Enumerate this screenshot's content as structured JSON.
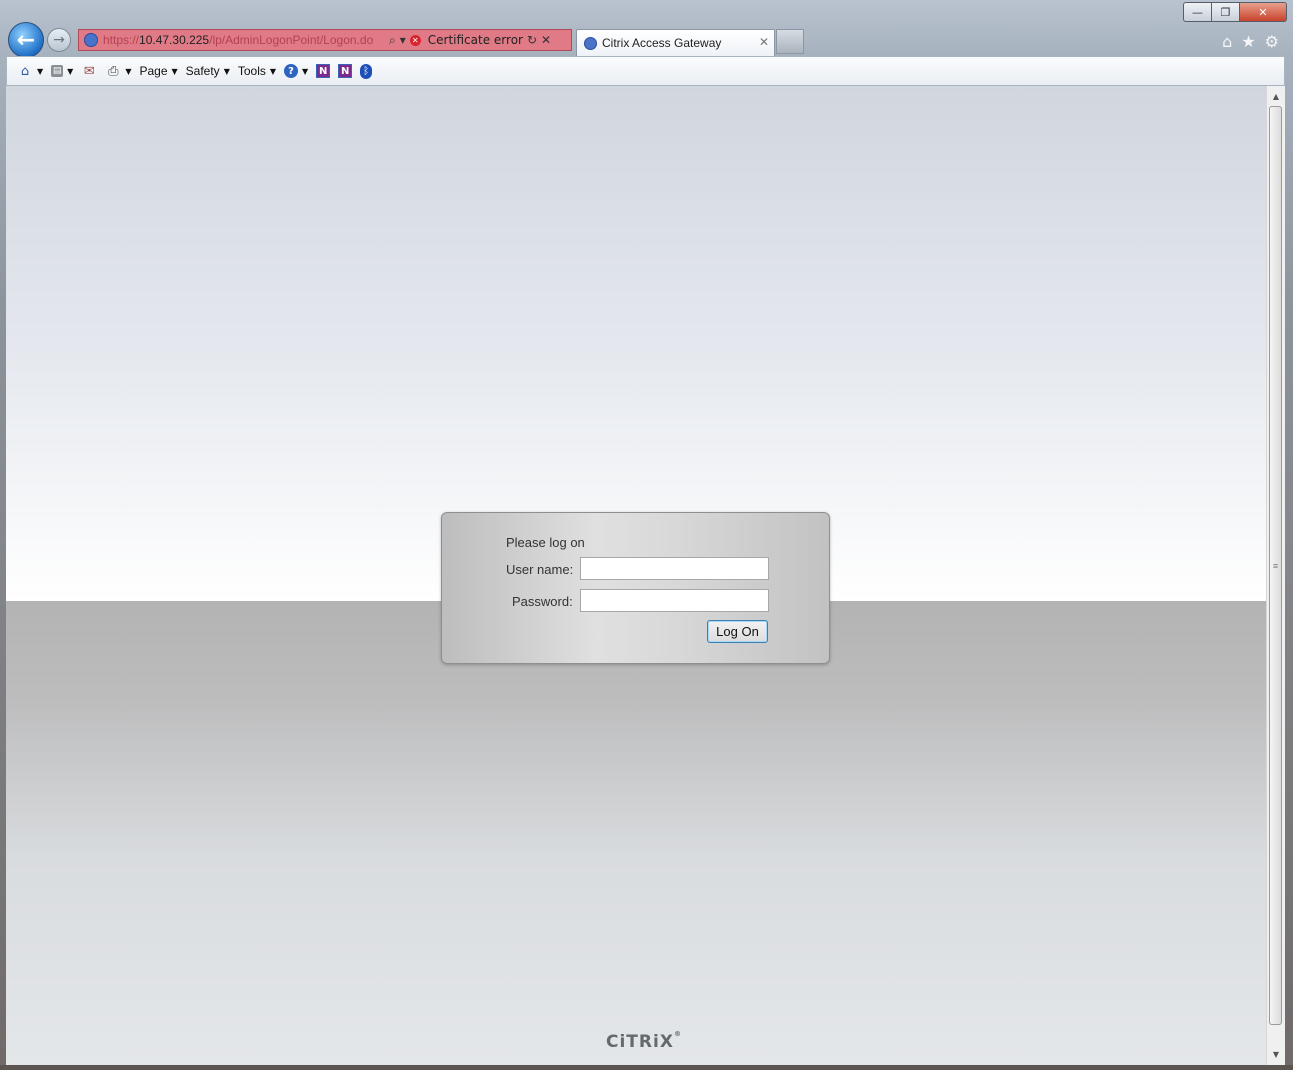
{
  "window": {
    "minimize_label": "—",
    "restore_label": "❐",
    "close_label": "✕"
  },
  "nav": {
    "back_icon": "←",
    "forward_icon": "→"
  },
  "address": {
    "url_scheme": "https://",
    "url_host": "10.47.30.225",
    "url_path": "/lp/AdminLogonPoint/Logon.do",
    "search_icon": "⌕",
    "dropdown_icon": "▾",
    "cert_error_icon": "✕",
    "cert_error_text": "Certificate error",
    "refresh_icon": "↻",
    "stop_icon": "✕",
    "error_color": "#e07a86"
  },
  "tab": {
    "title": "Citrix Access Gateway",
    "close_icon": "✕"
  },
  "browser_icons": {
    "home": "⌂",
    "favorites": "★",
    "tools": "⚙"
  },
  "toolbar": {
    "home_icon": "⌂",
    "feeds_icon": "▤",
    "mail_icon": "✉",
    "print_icon": "⎙",
    "page_label": "Page",
    "safety_label": "Safety",
    "tools_label": "Tools",
    "help_icon": "?",
    "onenote_send_icon": "N",
    "onenote_icon": "N",
    "bluetooth_icon": "ᛒ",
    "dropdown": "▼"
  },
  "scrollbar": {
    "up": "▲",
    "down": "▼",
    "grip": "≡"
  },
  "logon": {
    "title": "Please log on",
    "username_label": "User name:",
    "username_value": "",
    "password_label": "Password:",
    "password_value": "",
    "submit_label": "Log On"
  },
  "footer": {
    "logo_text": "CiTRiX",
    "logo_mark": "®"
  }
}
